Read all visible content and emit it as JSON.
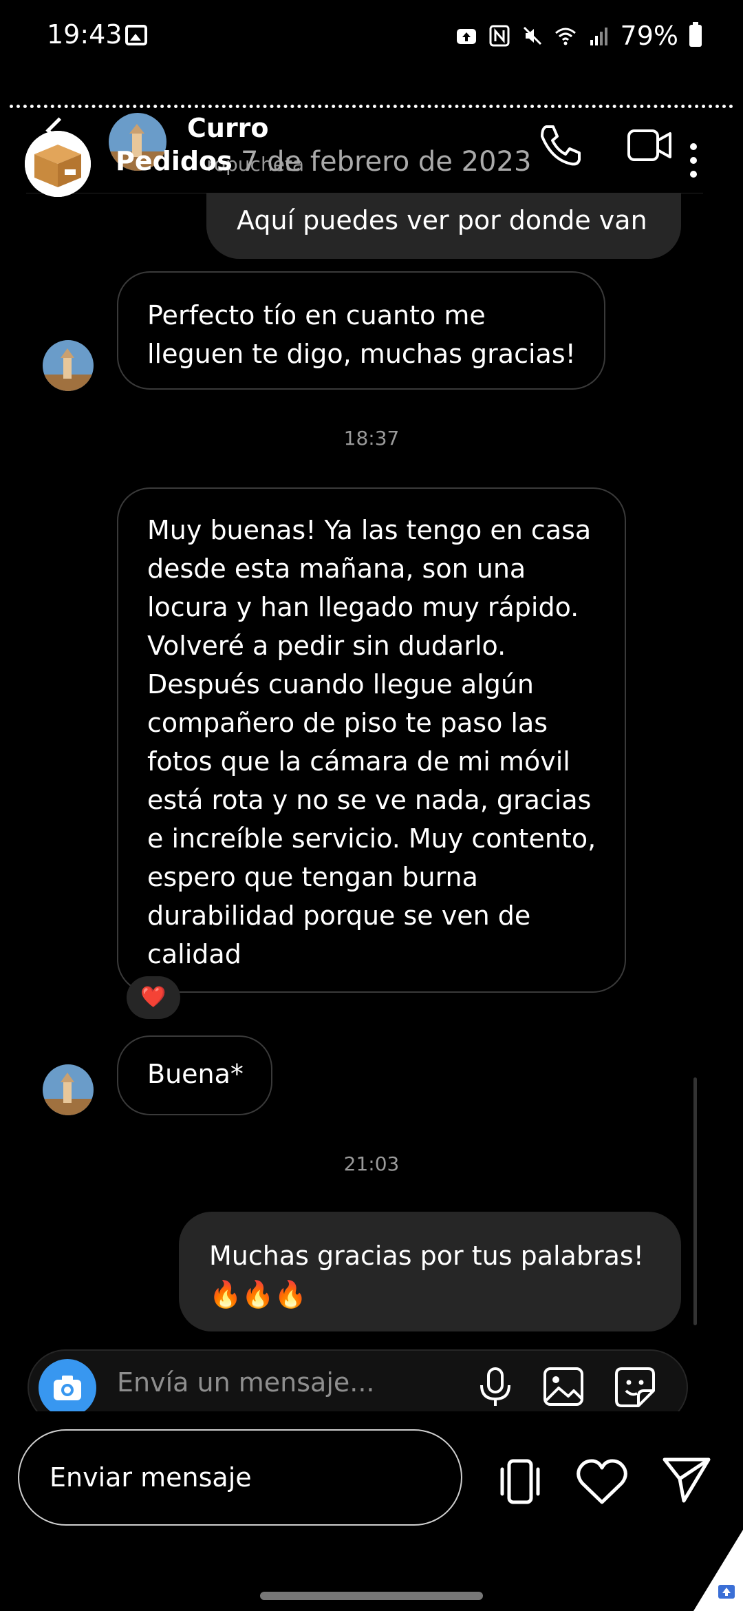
{
  "status_bar": {
    "time": "19:43",
    "battery": "79%"
  },
  "header": {
    "contact_name": "Curro",
    "contact_subtitle": "ropucheta",
    "share_target": "Pedidos",
    "date": "7 de febrero de 2023"
  },
  "messages": [
    {
      "direction": "out",
      "text": "Aquí puedes ver por donde van"
    },
    {
      "direction": "in",
      "text": "Perfecto tío en cuanto me lleguen te digo, muchas gracias!"
    },
    {
      "type": "timestamp",
      "text": "18:37"
    },
    {
      "direction": "in",
      "text": "Muy buenas! Ya las tengo en casa desde esta mañana, son una locura y han llegado muy rápido. Volveré a pedir sin dudarlo. Después cuando llegue algún compañero de piso te paso las fotos que la cámara de mi móvil está rota y no se ve nada, gracias e increíble servicio. Muy contento, espero que tengan burna durabilidad porque se ven de calidad",
      "reaction": "❤️"
    },
    {
      "direction": "in",
      "text": "Buena*"
    },
    {
      "type": "timestamp",
      "text": "21:03"
    },
    {
      "direction": "out",
      "text": "Muchas gracias por tus palabras! 🔥🔥🔥"
    }
  ],
  "composer": {
    "placeholder": "Envía un mensaje..."
  },
  "share_bar": {
    "send_label": "Enviar mensaje"
  },
  "colors": {
    "background": "#000000",
    "outgoing_bubble": "#262626",
    "incoming_border": "#3a3a3a",
    "camera_button": "#3897f0"
  }
}
